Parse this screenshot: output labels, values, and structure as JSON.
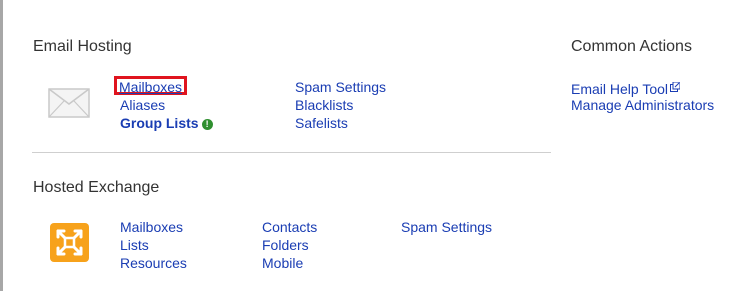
{
  "email_hosting": {
    "title": "Email Hosting",
    "col1": [
      "Mailboxes",
      "Aliases",
      "Group Lists"
    ],
    "col2": [
      "Spam Settings",
      "Blacklists",
      "Safelists"
    ],
    "group_lists_badge": "!"
  },
  "hosted_exchange": {
    "title": "Hosted Exchange",
    "col1": [
      "Mailboxes",
      "Lists",
      "Resources"
    ],
    "col2": [
      "Contacts",
      "Folders",
      "Mobile"
    ],
    "col3": [
      "Spam Settings"
    ]
  },
  "common_actions": {
    "title": "Common Actions",
    "links": [
      "Email Help Tool",
      "Manage Administrators"
    ]
  },
  "colors": {
    "link": "#1a3db3",
    "highlight": "#e0141e",
    "exchange_icon": "#f7a21b",
    "badge": "#2f8f2f"
  },
  "icons": {
    "email_hosting": "envelope-icon",
    "hosted_exchange": "exchange-icon",
    "help_tool": "external-link-icon",
    "group_lists": "info-icon"
  }
}
